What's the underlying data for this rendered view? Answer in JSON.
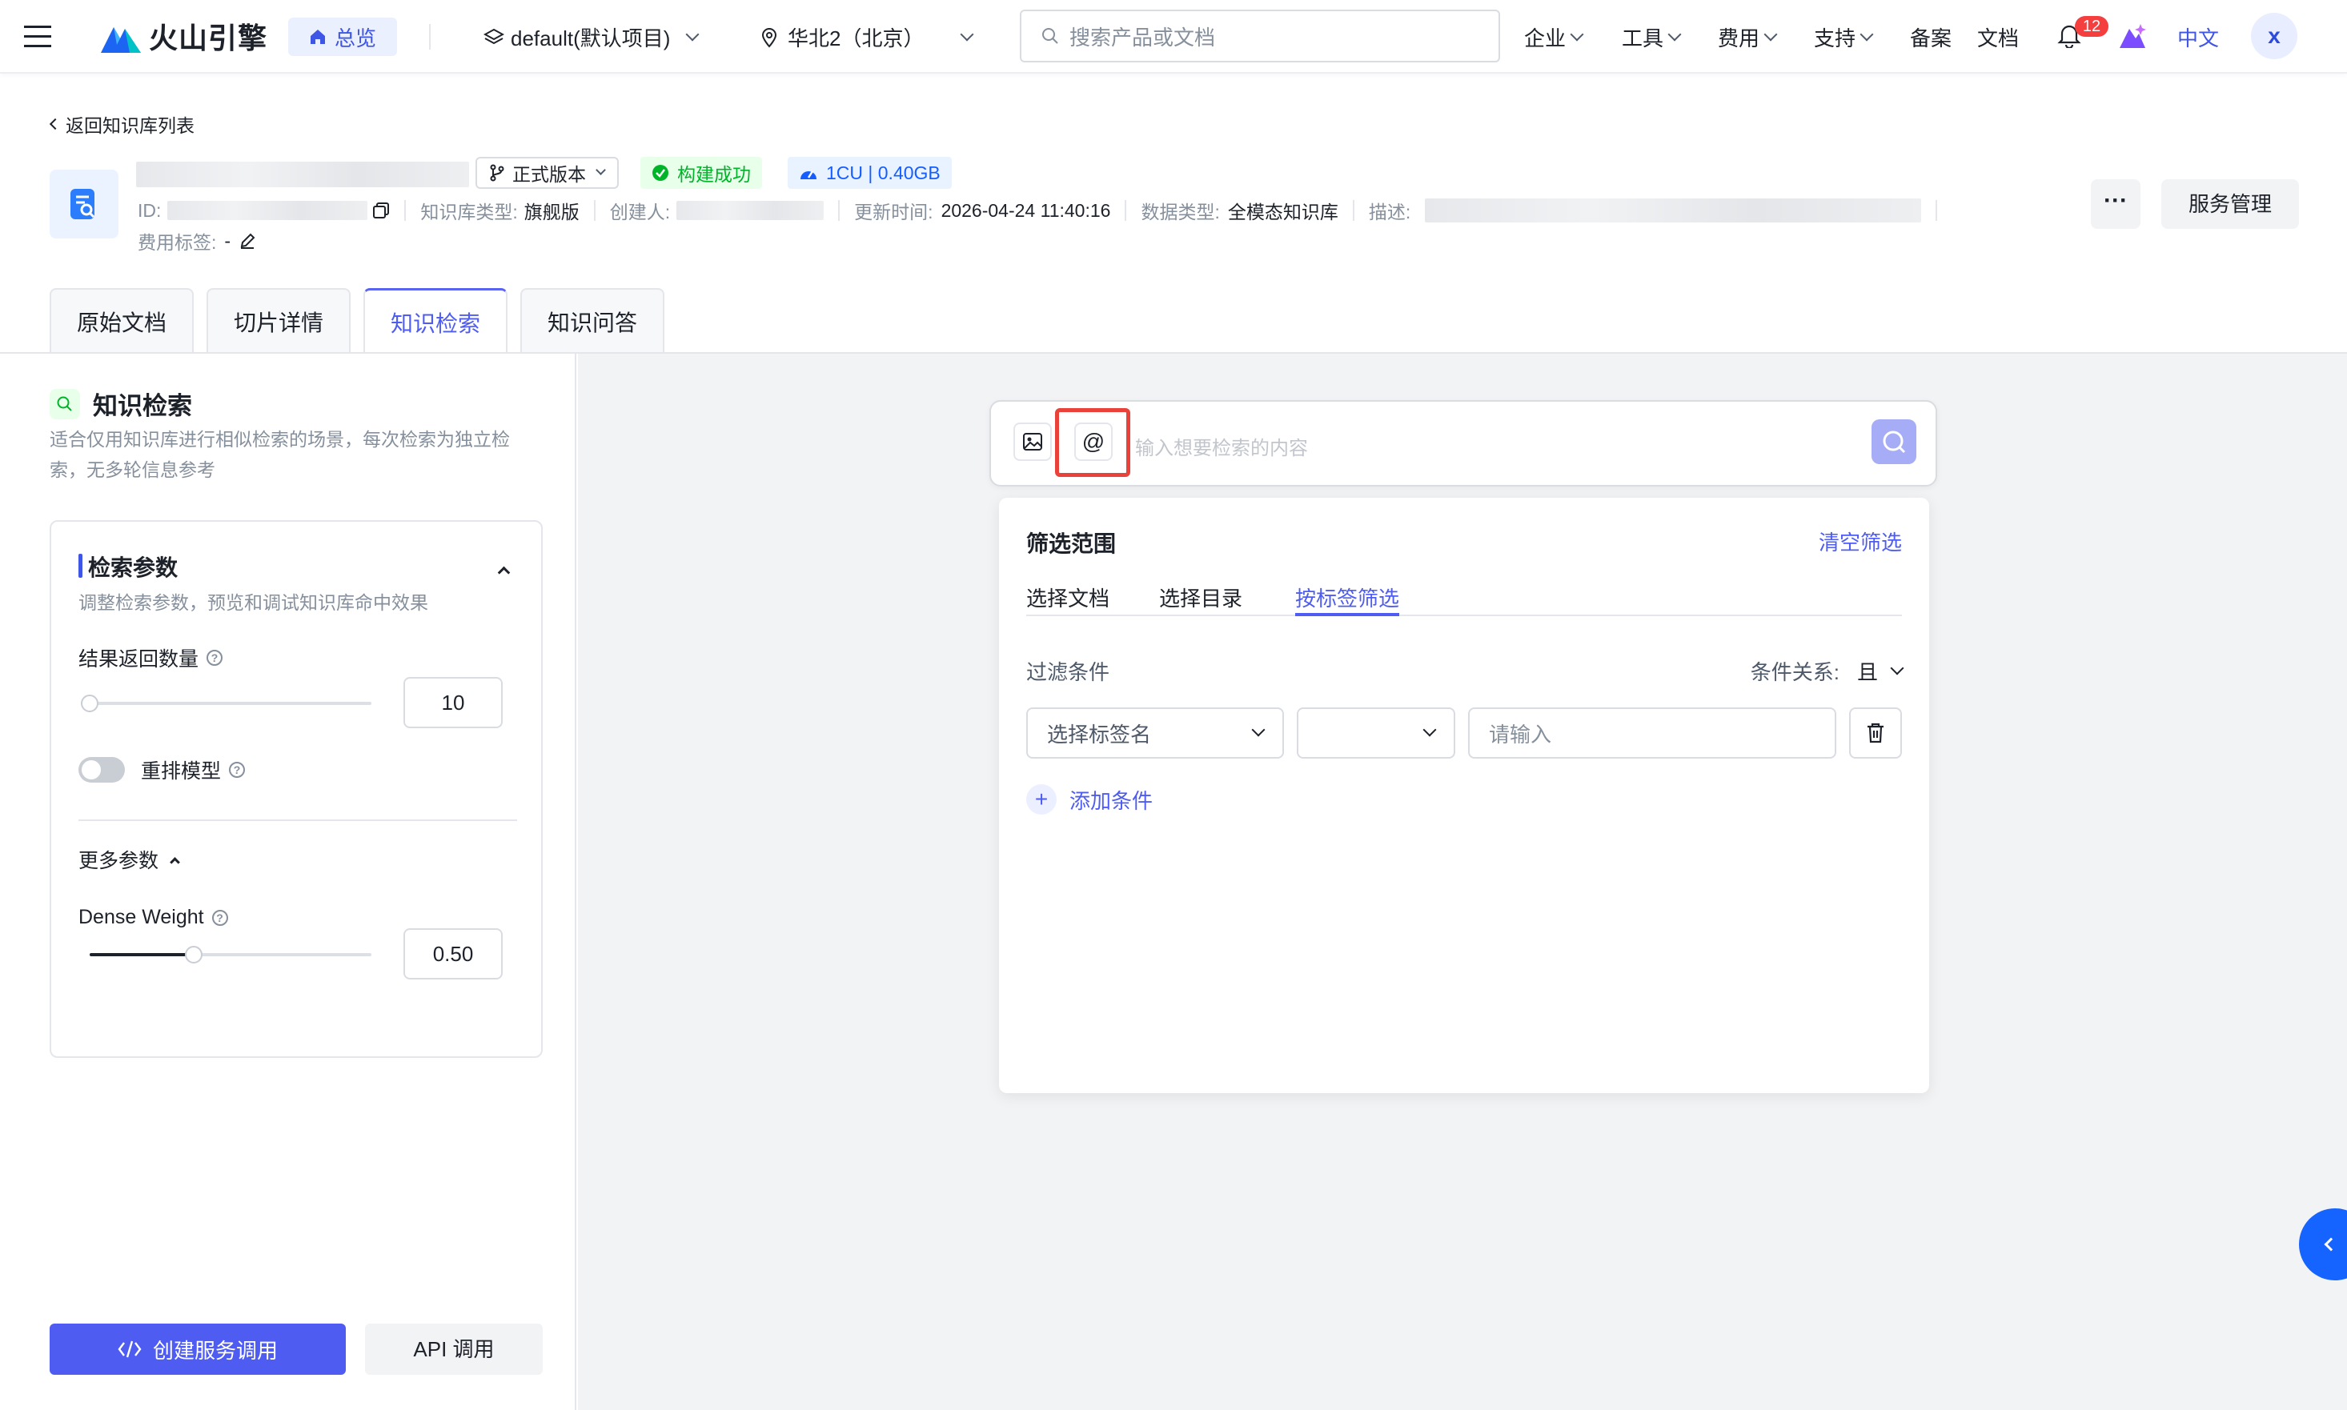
{
  "nav": {
    "brand": "火山引擎",
    "overview": "总览",
    "project": "default(默认项目)",
    "region": "华北2（北京）",
    "search_placeholder": "搜索产品或文档",
    "menu": [
      "企业",
      "工具",
      "费用",
      "支持"
    ],
    "links": [
      "备案",
      "文档"
    ],
    "notification_count": "12",
    "language": "中文",
    "avatar": "x"
  },
  "header": {
    "back_link": "返回知识库列表",
    "version": "正式版本",
    "build_status": "构建成功",
    "resource": "1CU | 0.40GB",
    "id_label": "ID:",
    "kb_type_label": "知识库类型:",
    "kb_type_value": "旗舰版",
    "creator_label": "创建人:",
    "updated_label": "更新时间:",
    "updated_value": "2026-04-24 11:40:16",
    "data_type_label": "数据类型:",
    "data_type_value": "全模态知识库",
    "desc_label": "描述:",
    "fee_label": "费用标签:",
    "fee_value": "-",
    "more_button": "···",
    "service_button": "服务管理"
  },
  "tabs": [
    "原始文档",
    "切片详情",
    "知识检索",
    "知识问答"
  ],
  "active_tab": "知识检索",
  "left": {
    "title": "知识检索",
    "description": "适合仅用知识库进行相似检索的场景，每次检索为独立检索，无多轮信息参考",
    "section_title": "检索参数",
    "section_desc": "调整检索参数，预览和调试知识库命中效果",
    "result_count_label": "结果返回数量",
    "result_count_value": "10",
    "result_count_fraction": 0.0,
    "rerank_label": "重排模型",
    "rerank_on": false,
    "more_params": "更多参数",
    "dense_weight_label": "Dense Weight",
    "dense_weight_value": "0.50",
    "dense_weight_fraction": 0.37,
    "create_service_button": "创建服务调用",
    "api_button": "API 调用"
  },
  "search": {
    "placeholder": "输入想要检索的内容",
    "at_symbol": "@"
  },
  "filter": {
    "title": "筛选范围",
    "clear": "清空筛选",
    "tabs": [
      "选择文档",
      "选择目录",
      "按标签筛选"
    ],
    "active_tab": "按标签筛选",
    "condition_label": "过滤条件",
    "relation_label": "条件关系:",
    "relation_value": "且",
    "tag_placeholder": "选择标签名",
    "value_placeholder": "请输入",
    "add_condition": "添加条件"
  },
  "colors": {
    "accent": "#4e5cf2",
    "success": "#00b42a",
    "highlight_border": "#e8423b"
  }
}
